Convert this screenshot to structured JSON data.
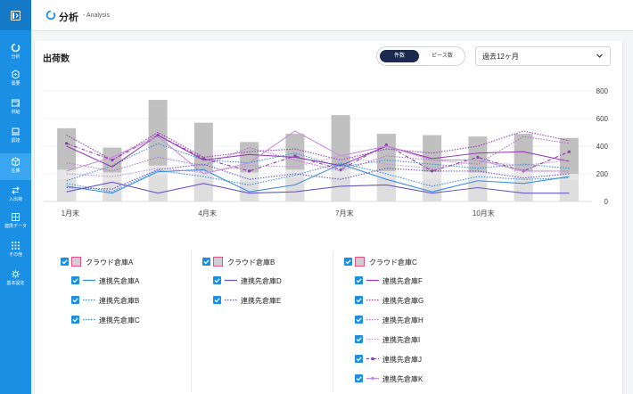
{
  "sidebar": {
    "items": [
      {
        "label": "分析",
        "icon": "analysis-ring-icon"
      },
      {
        "label": "需要",
        "icon": "demand-icon"
      },
      {
        "label": "供給",
        "icon": "supply-icon"
      },
      {
        "label": "調達",
        "icon": "procurement-laptop-icon"
      },
      {
        "label": "在庫",
        "icon": "inventory-cube-icon"
      },
      {
        "label": "入出荷",
        "icon": "transfer-arrows-icon"
      },
      {
        "label": "連携データ",
        "icon": "integration-grid-icon"
      },
      {
        "label": "その他",
        "icon": "dots-grid-icon"
      },
      {
        "label": "基本設定",
        "icon": "gear-icon"
      }
    ]
  },
  "header": {
    "title": "分析",
    "subtitle": "- Analysis"
  },
  "card": {
    "title": "出荷数",
    "toggle": {
      "active": "件数",
      "inactive": "ピース数"
    },
    "period": {
      "selected": "過去12ヶ月"
    }
  },
  "chart_data": {
    "type": "bar",
    "x": [
      "1",
      "2",
      "3",
      "4",
      "5",
      "6",
      "7",
      "8",
      "9",
      "10",
      "11",
      "12"
    ],
    "x_tick_labels": [
      {
        "index": 0,
        "label": "1月末"
      },
      {
        "index": 3,
        "label": "4月末"
      },
      {
        "index": 6,
        "label": "7月末"
      },
      {
        "index": 9,
        "label": "10月末"
      }
    ],
    "ylim": [
      0,
      800
    ],
    "yticks": [
      0,
      200,
      400,
      600,
      800
    ],
    "grid": true,
    "bars": {
      "series": [
        {
          "name": "クラウド倉庫A",
          "values": [
            530,
            390,
            735,
            570,
            430,
            490,
            625,
            490,
            480,
            470,
            490,
            460
          ]
        },
        {
          "name": "クラウド倉庫B",
          "values": [
            160,
            140,
            190,
            160,
            150,
            170,
            175,
            165,
            160,
            155,
            160,
            155
          ]
        },
        {
          "name": "クラウド倉庫C",
          "values": [
            230,
            210,
            260,
            220,
            210,
            230,
            250,
            220,
            215,
            210,
            220,
            200
          ]
        }
      ]
    },
    "series": [
      {
        "name": "連携先倉庫A",
        "style": "solid",
        "color": "#3a8fe0",
        "values": [
          110,
          60,
          215,
          230,
          70,
          120,
          270,
          160,
          70,
          150,
          130,
          180
        ]
      },
      {
        "name": "連携先倉庫B",
        "style": "dotted",
        "color": "#3a8fe0",
        "values": [
          130,
          70,
          225,
          180,
          120,
          190,
          280,
          200,
          110,
          180,
          160,
          170
        ]
      },
      {
        "name": "連携先倉庫C",
        "style": "dotted",
        "color": "#3a8fe0",
        "values": [
          150,
          260,
          420,
          300,
          280,
          350,
          250,
          300,
          270,
          240,
          270,
          240
        ]
      },
      {
        "name": "連携先倉庫D",
        "style": "solid",
        "color": "#6a58c8",
        "values": [
          70,
          140,
          60,
          130,
          60,
          70,
          110,
          120,
          60,
          100,
          60,
          60
        ]
      },
      {
        "name": "連携先倉庫E",
        "style": "dotted",
        "color": "#6a58c8",
        "values": [
          100,
          90,
          230,
          270,
          160,
          200,
          160,
          240,
          220,
          220,
          170,
          200
        ]
      },
      {
        "name": "連携先倉庫F",
        "style": "solid",
        "color": "#9b3fb5",
        "values": [
          400,
          250,
          480,
          300,
          340,
          320,
          260,
          400,
          310,
          350,
          360,
          290
        ]
      },
      {
        "name": "連携先倉庫G",
        "style": "dotted",
        "color": "#9b3fb5",
        "values": [
          480,
          300,
          500,
          320,
          360,
          380,
          300,
          380,
          350,
          400,
          510,
          440
        ]
      },
      {
        "name": "連携先倉庫H",
        "style": "dotted",
        "color": "#b370d0",
        "values": [
          280,
          220,
          320,
          260,
          390,
          300,
          220,
          330,
          300,
          270,
          470,
          420
        ]
      },
      {
        "name": "連携先倉庫I",
        "style": "dotted",
        "color": "#c58fdc",
        "values": [
          200,
          180,
          240,
          210,
          260,
          250,
          330,
          270,
          240,
          290,
          260,
          300
        ]
      },
      {
        "name": "連携先倉庫J",
        "style": "dash-dot",
        "color": "#8e3fb0",
        "values": [
          420,
          300,
          480,
          310,
          220,
          330,
          230,
          410,
          220,
          320,
          220,
          360
        ]
      },
      {
        "name": "連携先倉庫K",
        "style": "solid",
        "color": "#c88fe0",
        "values": [
          220,
          320,
          470,
          200,
          280,
          510,
          330,
          400,
          300,
          300,
          220,
          220
        ]
      }
    ]
  },
  "legend": {
    "groups": [
      {
        "name": "クラウド倉庫A",
        "items": [
          "連携先倉庫A",
          "連携先倉庫B",
          "連携先倉庫C"
        ]
      },
      {
        "name": "クラウド倉庫B",
        "items": [
          "連携先倉庫D",
          "連携先倉庫E"
        ]
      },
      {
        "name": "クラウド倉庫C",
        "items": [
          "連携先倉庫F",
          "連携先倉庫G",
          "連携先倉庫H",
          "連携先倉庫I",
          "連携先倉庫J",
          "連携先倉庫K"
        ]
      }
    ]
  }
}
